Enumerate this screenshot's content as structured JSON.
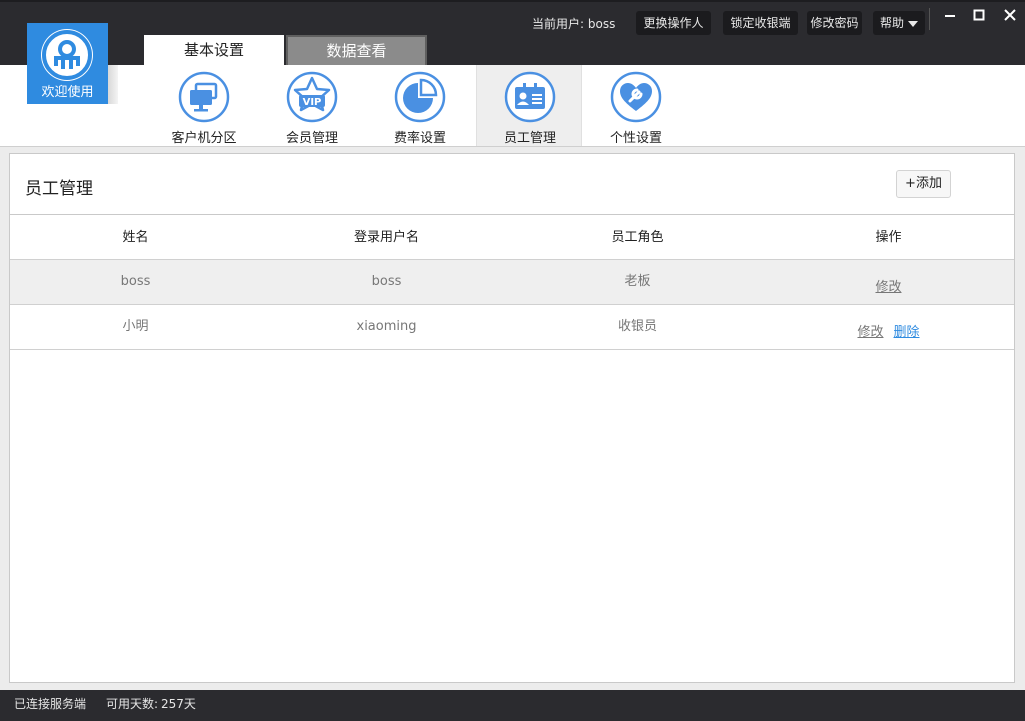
{
  "header": {
    "current_user_label": "当前用户: boss",
    "buttons": {
      "swap_operator": "更换操作人",
      "lock_register": "锁定收银端",
      "change_password": "修改密码",
      "help": "帮助"
    },
    "window_controls": {
      "minimize": "—",
      "maximize": "□",
      "close": "✕"
    }
  },
  "logo": {
    "text": "欢迎使用",
    "color": "#2f8be0"
  },
  "tabs": [
    {
      "label": "基本设置",
      "active": true
    },
    {
      "label": "数据查看",
      "active": false
    }
  ],
  "toolbar": {
    "items": [
      {
        "label": "客户机分区",
        "icon": "monitors-icon"
      },
      {
        "label": "会员管理",
        "icon": "vip-star-icon"
      },
      {
        "label": "费率设置",
        "icon": "pie-chart-icon"
      },
      {
        "label": "员工管理",
        "icon": "id-card-icon",
        "active": true
      },
      {
        "label": "个性设置",
        "icon": "heart-wrench-icon"
      }
    ],
    "accent": "#4a90e2"
  },
  "panel": {
    "title": "员工管理",
    "add_button": "+添加"
  },
  "table": {
    "columns": [
      "姓名",
      "登录用户名",
      "员工角色",
      "操作"
    ],
    "rows": [
      {
        "name": "boss",
        "username": "boss",
        "role": "老板",
        "actions": [
          "修改"
        ]
      },
      {
        "name": "小明",
        "username": "xiaoming",
        "role": "收银员",
        "actions": [
          "修改",
          "删除"
        ]
      }
    ]
  },
  "status_bar": {
    "connection": "已连接服务端",
    "days_label": "可用天数:",
    "days_value": "257天"
  }
}
